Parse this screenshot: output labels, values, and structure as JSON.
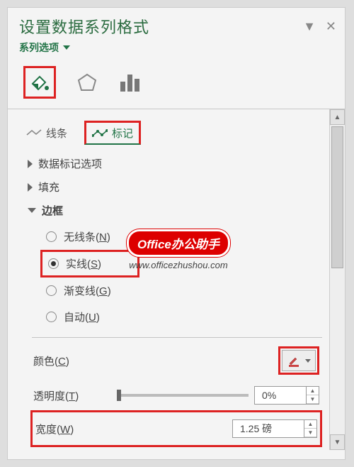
{
  "pane": {
    "title": "设置数据系列格式",
    "dropdown_label": "系列选项"
  },
  "subtabs": {
    "line": "线条",
    "marker": "标记"
  },
  "sections": {
    "marker_options": "数据标记选项",
    "fill": "填充",
    "border": "边框"
  },
  "border_options": {
    "none": {
      "text": "无线条",
      "key": "N"
    },
    "solid": {
      "text": "实线",
      "key": "S"
    },
    "gradient": {
      "text": "渐变线",
      "key": "G"
    },
    "auto": {
      "text": "自动",
      "key": "U"
    }
  },
  "props": {
    "color": {
      "label": "颜色",
      "key": "C"
    },
    "transparency": {
      "label": "透明度",
      "key": "T",
      "value": "0%"
    },
    "width": {
      "label": "宽度",
      "key": "W",
      "value": "1.25 磅"
    }
  },
  "watermark": {
    "badge": "Office办公助手",
    "url": "www.officezhushou.com"
  }
}
